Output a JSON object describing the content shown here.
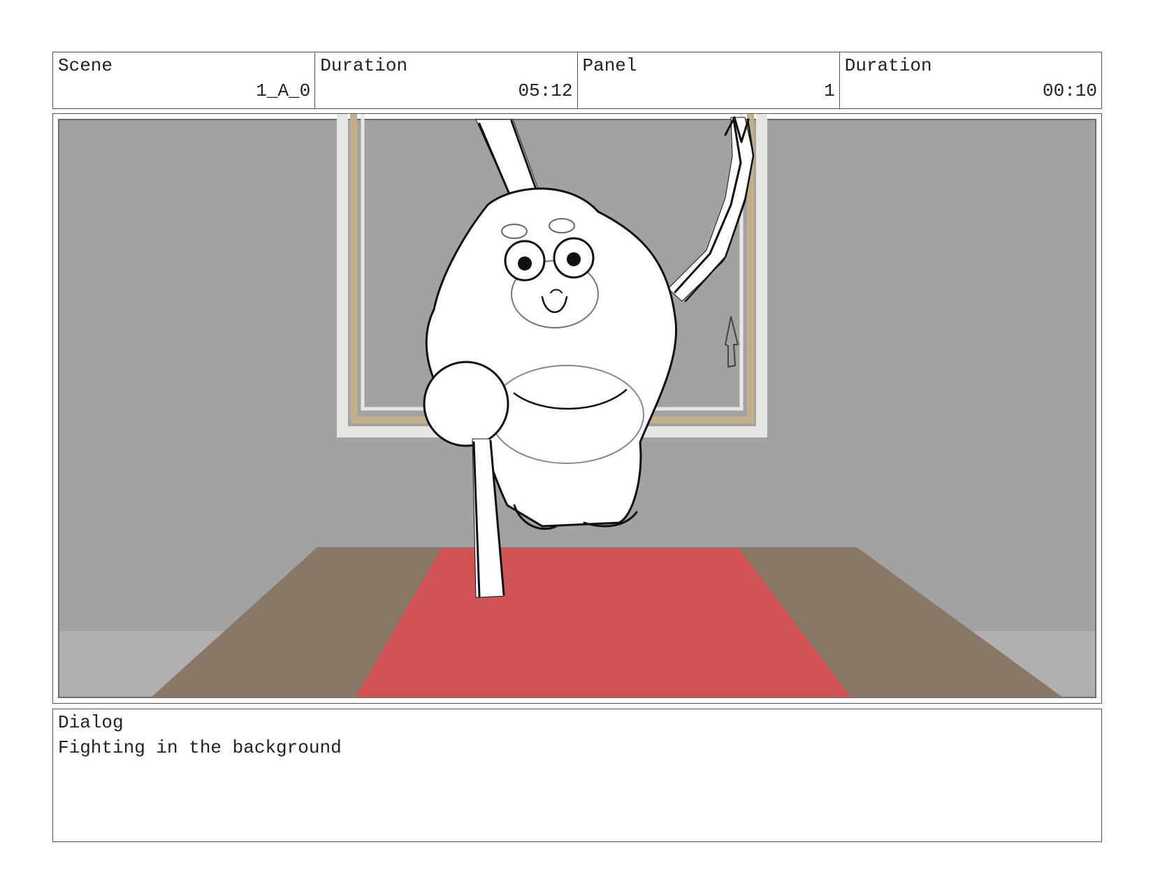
{
  "header": {
    "scene_label": "Scene",
    "scene_value": "1_A_0",
    "scene_duration_label": "Duration",
    "scene_duration_value": "05:12",
    "panel_label": "Panel",
    "panel_value": "1",
    "panel_duration_label": "Duration",
    "panel_duration_value": "00:10"
  },
  "panel_image": {
    "colors": {
      "wall": "#a2a2a2",
      "floor": "#b0b0b0",
      "table": "#8a7866",
      "runner": "#d05254",
      "window_frame": "#c2b08a",
      "window_trim": "#e8e6e2",
      "sketch_fill": "#ffffff",
      "sketch_line": "#111111"
    }
  },
  "dialog": {
    "label": "Dialog",
    "text": "Fighting in the background"
  }
}
